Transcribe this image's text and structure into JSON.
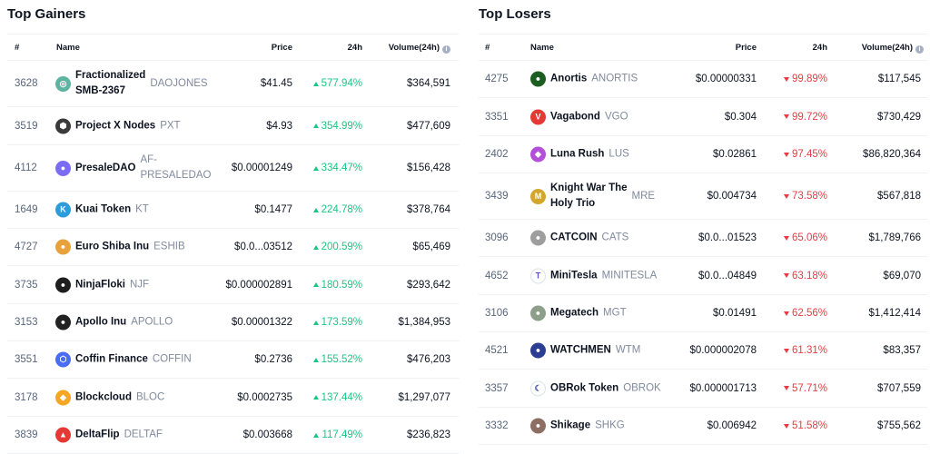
{
  "headers": {
    "rank": "#",
    "name": "Name",
    "price": "Price",
    "change": "24h",
    "volume": "Volume(24h)",
    "info_glyph": "i"
  },
  "gainers": {
    "title": "Top Gainers",
    "rows": [
      {
        "rank": "3628",
        "name": "Fractionalized SMB-2367",
        "name_l1": "Fractionalized",
        "name_l2": "SMB-2367",
        "symbol": "DAOJONES",
        "price": "$41.45",
        "change": "577.94%",
        "volume": "$364,591",
        "icon_color": "#5fb3a1",
        "icon_glyph": "◎",
        "icon_name": "coin-icon"
      },
      {
        "rank": "3519",
        "name": "Project X Nodes",
        "symbol": "PXT",
        "price": "$4.93",
        "change": "354.99%",
        "volume": "$477,609",
        "icon_color": "#3a3a3a",
        "icon_glyph": "⬢",
        "icon_name": "coin-icon"
      },
      {
        "rank": "4112",
        "name": "PresaleDAO",
        "symbol": "AF-PRESALEDAO",
        "sym_l1": "AF-",
        "sym_l2": "PRESALEDAO",
        "price": "$0.00001249",
        "change": "334.47%",
        "volume": "$156,428",
        "icon_color": "#7b6cf6",
        "icon_glyph": "●",
        "icon_name": "coin-icon"
      },
      {
        "rank": "1649",
        "name": "Kuai Token",
        "symbol": "KT",
        "price": "$0.1477",
        "change": "224.78%",
        "volume": "$378,764",
        "icon_color": "#2d9cdb",
        "icon_glyph": "K",
        "icon_name": "coin-icon"
      },
      {
        "rank": "4727",
        "name": "Euro Shiba Inu",
        "symbol": "ESHIB",
        "price": "$0.0...03512",
        "change": "200.59%",
        "volume": "$65,469",
        "icon_color": "#e9a23b",
        "icon_glyph": "●",
        "icon_name": "coin-icon"
      },
      {
        "rank": "3735",
        "name": "NinjaFloki",
        "symbol": "NJF",
        "price": "$0.000002891",
        "change": "180.59%",
        "volume": "$293,642",
        "icon_color": "#1e1e1e",
        "icon_glyph": "●",
        "icon_name": "coin-icon"
      },
      {
        "rank": "3153",
        "name": "Apollo Inu",
        "symbol": "APOLLO",
        "price": "$0.00001322",
        "change": "173.59%",
        "volume": "$1,384,953",
        "icon_color": "#222222",
        "icon_glyph": "●",
        "icon_name": "coin-icon"
      },
      {
        "rank": "3551",
        "name": "Coffin Finance",
        "symbol": "COFFIN",
        "price": "$0.2736",
        "change": "155.52%",
        "volume": "$476,203",
        "icon_color": "#4a6cf7",
        "icon_glyph": "⬡",
        "icon_name": "coin-icon"
      },
      {
        "rank": "3178",
        "name": "Blockcloud",
        "symbol": "BLOC",
        "price": "$0.0002735",
        "change": "137.44%",
        "volume": "$1,297,077",
        "icon_color": "#f5a623",
        "icon_glyph": "◆",
        "icon_name": "coin-icon"
      },
      {
        "rank": "3839",
        "name": "DeltaFlip",
        "symbol": "DELTAF",
        "price": "$0.003668",
        "change": "117.49%",
        "volume": "$236,823",
        "icon_color": "#e53935",
        "icon_glyph": "▲",
        "icon_name": "coin-icon"
      }
    ]
  },
  "losers": {
    "title": "Top Losers",
    "rows": [
      {
        "rank": "4275",
        "name": "Anortis",
        "symbol": "ANORTIS",
        "price": "$0.00000331",
        "change": "99.89%",
        "volume": "$117,545",
        "icon_color": "#1b5e20",
        "icon_glyph": "●",
        "icon_name": "coin-icon"
      },
      {
        "rank": "3351",
        "name": "Vagabond",
        "symbol": "VGO",
        "price": "$0.304",
        "change": "99.72%",
        "volume": "$730,429",
        "icon_color": "#e53935",
        "icon_glyph": "V",
        "icon_name": "coin-icon"
      },
      {
        "rank": "2402",
        "name": "Luna Rush",
        "symbol": "LUS",
        "price": "$0.02861",
        "change": "97.45%",
        "volume": "$86,820,364",
        "icon_color": "#b34fd8",
        "icon_glyph": "◆",
        "icon_name": "coin-icon"
      },
      {
        "rank": "3439",
        "name": "Knight War The Holy Trio",
        "name_l1": "Knight War The",
        "name_l2": "Holy Trio",
        "symbol": "MRE",
        "price": "$0.004734",
        "change": "73.58%",
        "volume": "$567,818",
        "icon_color": "#d4a72c",
        "icon_glyph": "M",
        "icon_name": "coin-icon"
      },
      {
        "rank": "3096",
        "name": "CATCOIN",
        "symbol": "CATS",
        "price": "$0.0...01523",
        "change": "65.06%",
        "volume": "$1,789,766",
        "icon_color": "#9e9e9e",
        "icon_glyph": "●",
        "icon_name": "coin-icon"
      },
      {
        "rank": "4652",
        "name": "MiniTesla",
        "symbol": "MINITESLA",
        "price": "$0.0...04849",
        "change": "63.18%",
        "volume": "$69,070",
        "icon_color": "#ffffff",
        "icon_glyph": "T",
        "icon_name": "coin-icon",
        "icon_fg": "#5b4bd6"
      },
      {
        "rank": "3106",
        "name": "Megatech",
        "symbol": "MGT",
        "price": "$0.01491",
        "change": "62.56%",
        "volume": "$1,412,414",
        "icon_color": "#8d9e8a",
        "icon_glyph": "●",
        "icon_name": "coin-icon"
      },
      {
        "rank": "4521",
        "name": "WATCHMEN",
        "symbol": "WTM",
        "price": "$0.000002078",
        "change": "61.31%",
        "volume": "$83,357",
        "icon_color": "#2c3e91",
        "icon_glyph": "●",
        "icon_name": "coin-icon"
      },
      {
        "rank": "3357",
        "name": "OBRok Token",
        "symbol": "OBROK",
        "price": "$0.000001713",
        "change": "57.71%",
        "volume": "$707,559",
        "icon_color": "#ffffff",
        "icon_glyph": "☾",
        "icon_name": "coin-icon",
        "icon_fg": "#3949ab"
      },
      {
        "rank": "3332",
        "name": "Shikage",
        "symbol": "SHKG",
        "price": "$0.006942",
        "change": "51.58%",
        "volume": "$755,562",
        "icon_color": "#8d6e63",
        "icon_glyph": "●",
        "icon_name": "coin-icon"
      }
    ]
  }
}
